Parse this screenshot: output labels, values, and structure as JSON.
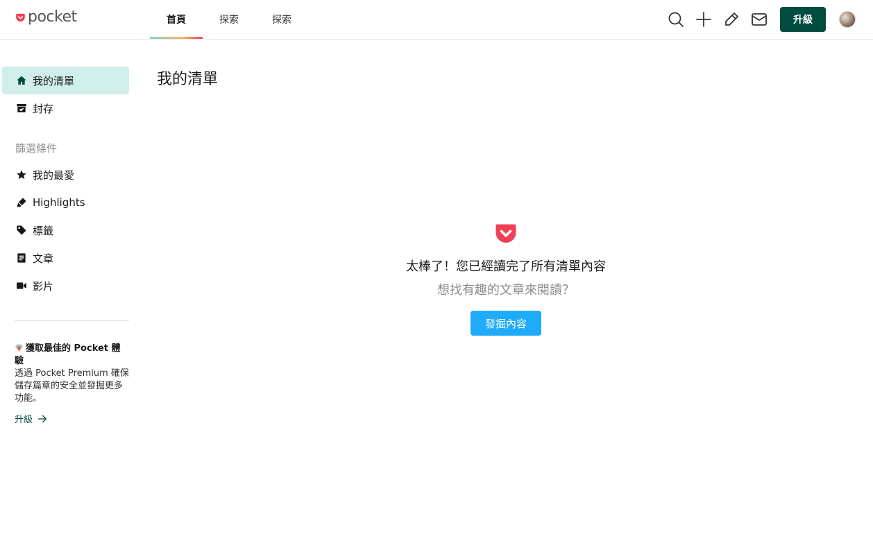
{
  "brand": {
    "name": "pocket",
    "color": "#ef4056"
  },
  "nav": {
    "tabs": [
      {
        "label": "首頁",
        "active": true
      },
      {
        "label": "探索",
        "active": false
      },
      {
        "label": "探索",
        "active": false
      }
    ]
  },
  "toolbar": {
    "icons": [
      "search-icon",
      "add-icon",
      "highlighter-icon",
      "mail-icon"
    ],
    "upgrade_label": "升級"
  },
  "sidebar": {
    "items": [
      {
        "label": "我的清單",
        "icon": "home-icon",
        "active": true
      },
      {
        "label": "封存",
        "icon": "archive-icon",
        "active": false
      }
    ],
    "filter_heading": "篩選條件",
    "filters": [
      {
        "label": "我的最愛",
        "icon": "star-icon"
      },
      {
        "label": "Highlights",
        "icon": "highlight-icon"
      },
      {
        "label": "標籤",
        "icon": "tag-icon"
      },
      {
        "label": "文章",
        "icon": "article-icon"
      },
      {
        "label": "影片",
        "icon": "video-icon"
      }
    ],
    "promo": {
      "title": "獲取最佳的 Pocket 體驗",
      "body": "透過 Pocket Premium 確保儲存篇章的安全並發掘更多功能。",
      "link_label": "升級"
    }
  },
  "main": {
    "title": "我的清單",
    "empty_state": {
      "title": "太棒了！您已經讀完了所有清單內容",
      "subtitle": "想找有趣的文章來閱讀？",
      "button_label": "發掘內容"
    }
  },
  "colors": {
    "accent_dark": "#004d40",
    "active_bg": "#d0eeea",
    "discover_blue": "#1eabf9",
    "muted_text": "#8c8c8c"
  }
}
